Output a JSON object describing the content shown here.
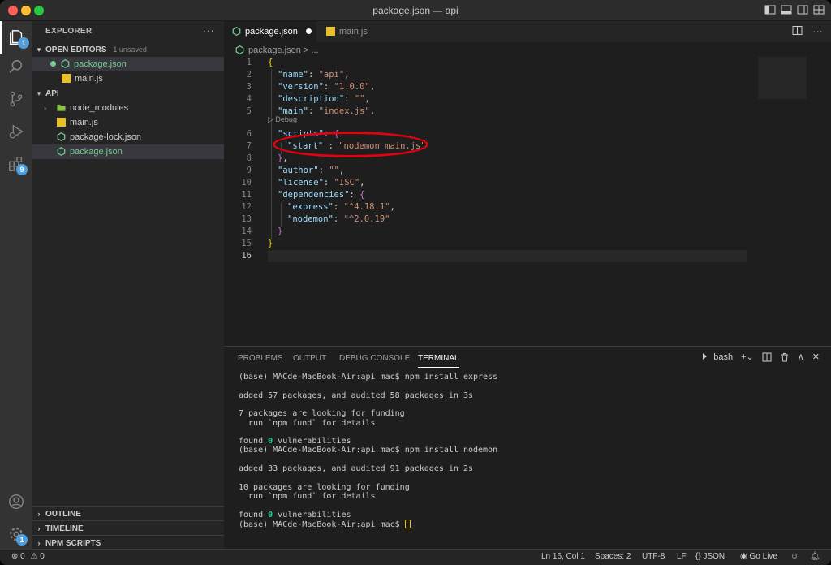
{
  "window": {
    "title": "package.json — api"
  },
  "activity_bar": {
    "explorer_badge": "1",
    "extensions_badge": "9",
    "settings_badge": "1"
  },
  "sidebar": {
    "header": "EXPLORER",
    "more": "···",
    "open_editors": {
      "label": "OPEN EDITORS",
      "unsaved": "1 unsaved",
      "items": [
        {
          "label": "package.json"
        },
        {
          "label": "main.js"
        }
      ]
    },
    "project": {
      "label": "API",
      "items": [
        {
          "label": "node_modules"
        },
        {
          "label": "main.js"
        },
        {
          "label": "package-lock.json"
        },
        {
          "label": "package.json"
        }
      ]
    },
    "bottom_sections": [
      "OUTLINE",
      "TIMELINE",
      "NPM SCRIPTS"
    ]
  },
  "editor": {
    "tabs": [
      {
        "label": "package.json"
      },
      {
        "label": "main.js"
      }
    ],
    "breadcrumb": "package.json > ...",
    "code_lens": "▷ Debug",
    "line_numbers": [
      "1",
      "2",
      "3",
      "4",
      "5",
      "6",
      "7",
      "8",
      "9",
      "10",
      "11",
      "12",
      "13",
      "14",
      "15",
      "16"
    ],
    "lines": {
      "l1": "{",
      "l2_key": "\"name\"",
      "l2_val": "\"api\"",
      "l3_key": "\"version\"",
      "l3_val": "\"1.0.0\"",
      "l4_key": "\"description\"",
      "l4_val": "\"\"",
      "l5_key": "\"main\"",
      "l5_val": "\"index.js\"",
      "l6_key": "\"scripts\"",
      "l6_val": "{",
      "l7_key": "\"start\"",
      "l7_val": "\"nodemon main.js\"",
      "l8": "}",
      "l9_key": "\"author\"",
      "l9_val": "\"\"",
      "l10_key": "\"license\"",
      "l10_val": "\"ISC\"",
      "l11_key": "\"dependencies\"",
      "l11_val": "{",
      "l12_key": "\"express\"",
      "l12_val": "\"^4.18.1\"",
      "l13_key": "\"nodemon\"",
      "l13_val": "\"^2.0.19\"",
      "l14": "}",
      "l15": "}"
    }
  },
  "panel": {
    "tabs": [
      "PROBLEMS",
      "OUTPUT",
      "DEBUG CONSOLE",
      "TERMINAL"
    ],
    "shell": "bash",
    "terminal_lines": [
      "(base) MACde-MacBook-Air:api mac$ npm install express",
      "",
      "added 57 packages, and audited 58 packages in 3s",
      "",
      "7 packages are looking for funding",
      "  run `npm fund` for details",
      "",
      "found ",
      "(base) MACde-MacBook-Air:api mac$ npm install nodemon",
      "",
      "added 33 packages, and audited 91 packages in 2s",
      "",
      "10 packages are looking for funding",
      "  run `npm fund` for details",
      "",
      "found ",
      "(base) MACde-MacBook-Air:api mac$ "
    ],
    "found_zero": "0",
    "found_suffix": " vulnerabilities"
  },
  "status_bar": {
    "errors": "0",
    "warnings": "0",
    "position": "Ln 16, Col 1",
    "spaces": "Spaces: 2",
    "encoding": "UTF-8",
    "eol": "LF",
    "language_braces": "{}",
    "language": "JSON",
    "go_live": "Go Live"
  },
  "colors": {
    "accent_badge": "#4d9fe0",
    "highlight_ellipse": "#e3000f",
    "json_icon": "#73c991",
    "js_icon": "#e8bf2a"
  }
}
